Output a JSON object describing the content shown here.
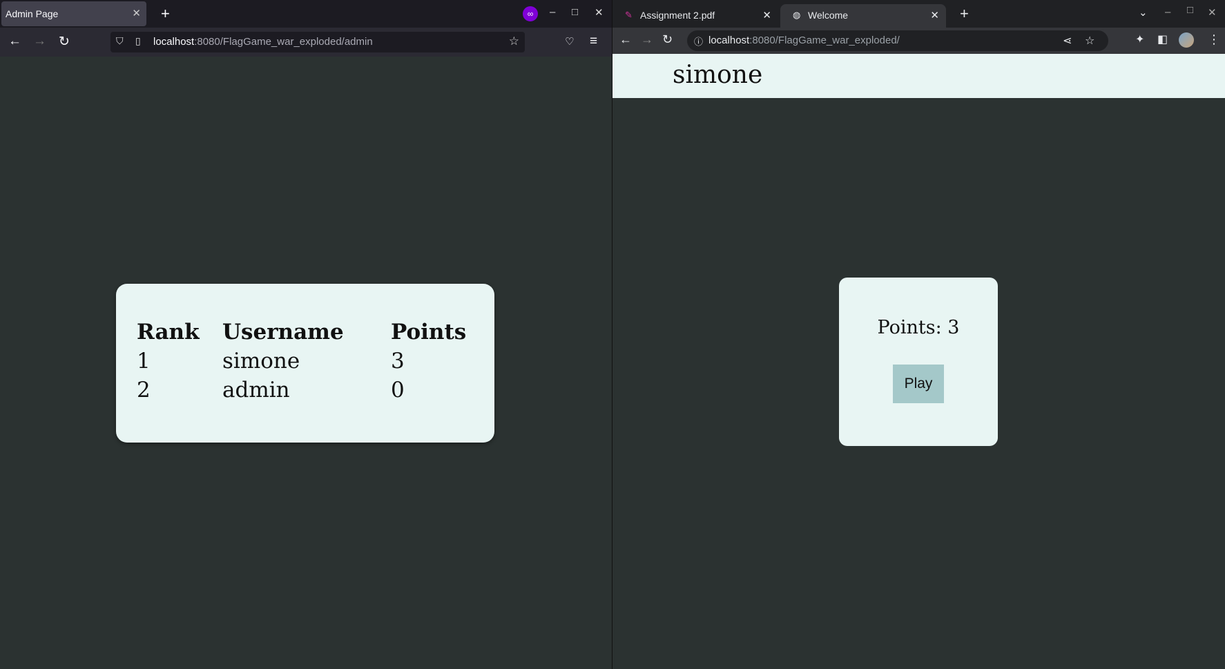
{
  "left_window": {
    "tab_title": "Admin Page",
    "url_host": "localhost",
    "url_rest": ":8080/FlagGame_war_exploded/admin",
    "leaderboard": {
      "headers": [
        "Rank",
        "Username",
        "Points"
      ],
      "rows": [
        {
          "rank": "1",
          "username": "simone",
          "points": "3"
        },
        {
          "rank": "2",
          "username": "admin",
          "points": "0"
        }
      ]
    }
  },
  "right_window": {
    "tabs": [
      {
        "label": "Assignment 2.pdf",
        "icon": "pdf-icon"
      },
      {
        "label": "Welcome",
        "icon": "globe-icon"
      }
    ],
    "url_host": "localhost",
    "url_rest": ":8080/FlagGame_war_exploded/",
    "header_username": "simone",
    "points_text": "Points: 3",
    "play_label": "Play"
  },
  "colors": {
    "page_background": "#2b3231",
    "card_background": "#e8f5f3",
    "play_button": "#a4c8c9",
    "private_badge": "#8000d7"
  }
}
